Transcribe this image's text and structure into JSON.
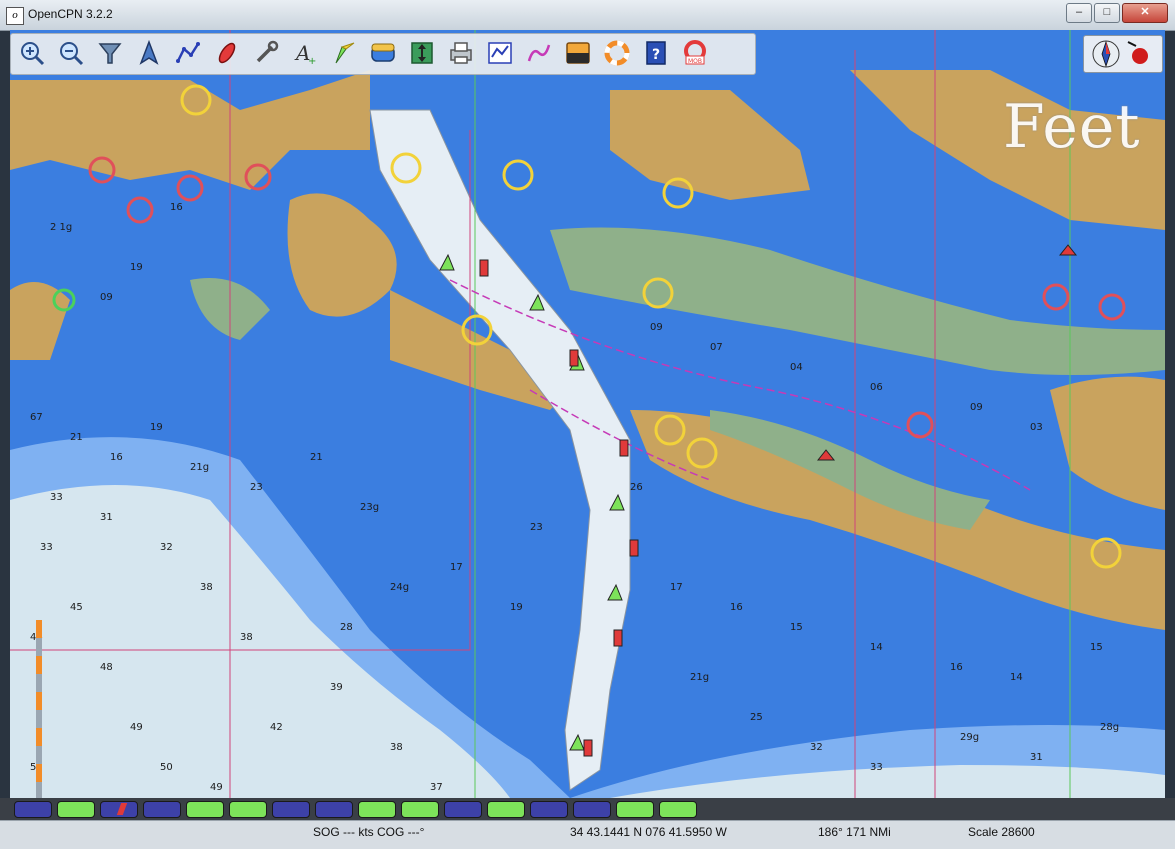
{
  "window": {
    "title": "OpenCPN 3.2.2",
    "buttons": [
      "–",
      "□",
      "✕"
    ]
  },
  "toolbar": {
    "tools": [
      {
        "name": "zoom-in-icon",
        "tooltip": "Zoom In"
      },
      {
        "name": "zoom-out-icon",
        "tooltip": "Zoom Out"
      },
      {
        "name": "chart-quilt-icon",
        "tooltip": "Shift to Larger Scale Chart"
      },
      {
        "name": "ship-follow-icon",
        "tooltip": "Auto Follow"
      },
      {
        "name": "route-icon",
        "tooltip": "Create Route"
      },
      {
        "name": "mark-icon",
        "tooltip": "Drop Mark"
      },
      {
        "name": "settings-wrench-icon",
        "tooltip": "ToolBox"
      },
      {
        "name": "text-icon",
        "tooltip": "Show ENC Text"
      },
      {
        "name": "light-icon",
        "tooltip": "Show ENC Lights"
      },
      {
        "name": "tide-icon",
        "tooltip": "Show Tides"
      },
      {
        "name": "current-icon",
        "tooltip": "Show Currents"
      },
      {
        "name": "print-icon",
        "tooltip": "Print Chart"
      },
      {
        "name": "route-manager-icon",
        "tooltip": "Route & Mark Manager"
      },
      {
        "name": "track-icon",
        "tooltip": "Enable Tracking"
      },
      {
        "name": "color-scheme-icon",
        "tooltip": "Change Color Scheme"
      },
      {
        "name": "lifebuoy-icon",
        "tooltip": "Drop MOB Marker"
      },
      {
        "name": "help-icon",
        "tooltip": "About OpenCPN"
      },
      {
        "name": "mob-icon",
        "tooltip": "Man Overboard"
      }
    ]
  },
  "chart": {
    "units_overlay": "Feet",
    "colors": {
      "deep_water": "#d6e6ef",
      "medium_water": "#7fb1f2",
      "shallow_water": "#3b7ee0",
      "land": "#c9a35e",
      "intertidal": "#8fb08a",
      "channel": "#e6eef5"
    }
  },
  "piano": {
    "keys": [
      "blue",
      "green",
      "red-blue",
      "blue",
      "green",
      "green",
      "blue",
      "blue",
      "green",
      "green",
      "blue",
      "green",
      "blue",
      "blue",
      "green",
      "green"
    ]
  },
  "status": {
    "sog_cog": "SOG --- kts  COG ---°",
    "position": "34 43.1441 N   076 41.5950 W",
    "bearing_range": "186°  171 NMi",
    "scale": "Scale 28600"
  }
}
